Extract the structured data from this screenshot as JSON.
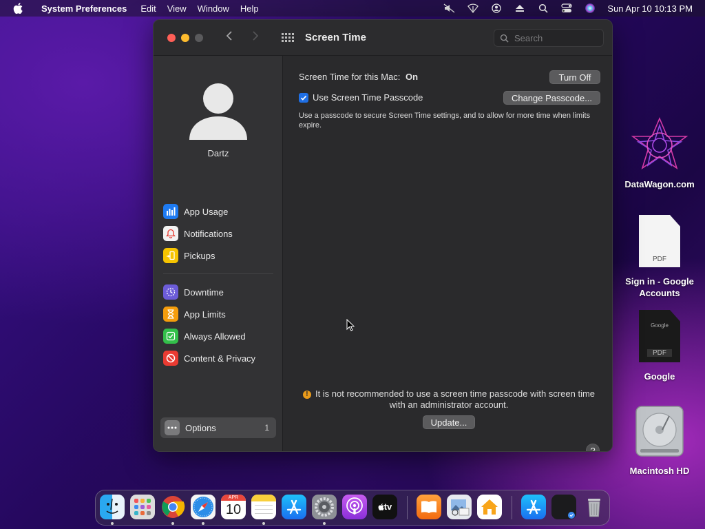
{
  "menubar": {
    "app_name": "System Preferences",
    "items": [
      "Edit",
      "View",
      "Window",
      "Help"
    ],
    "clock": "Sun Apr 10  10:13 PM",
    "tray_icons": [
      "mute-icon",
      "wifi-icon",
      "user-icon",
      "eject-icon",
      "search-icon",
      "control-center-icon",
      "siri-icon"
    ]
  },
  "window": {
    "title": "Screen Time",
    "search_placeholder": "Search"
  },
  "sidebar": {
    "user_name": "Dartz",
    "items": [
      {
        "label": "App Usage",
        "icon": "app-usage-icon",
        "color": "#1e7bf2"
      },
      {
        "label": "Notifications",
        "icon": "notifications-icon",
        "color": "#f2f2f2"
      },
      {
        "label": "Pickups",
        "icon": "pickups-icon",
        "color": "#f6c400"
      },
      {
        "label": "Downtime",
        "icon": "downtime-icon",
        "color": "#6c5cd8"
      },
      {
        "label": "App Limits",
        "icon": "app-limits-icon",
        "color": "#f59d0c"
      },
      {
        "label": "Always Allowed",
        "icon": "always-allowed-icon",
        "color": "#33c04a"
      },
      {
        "label": "Content & Privacy",
        "icon": "content-privacy-icon",
        "color": "#ea3b32"
      }
    ],
    "options": {
      "label": "Options",
      "badge": "1"
    }
  },
  "main": {
    "status_label": "Screen Time for this Mac:",
    "status_value": "On",
    "turn_off_label": "Turn Off",
    "passcode_label": "Use Screen Time Passcode",
    "change_passcode_label": "Change Passcode...",
    "description": "Use a passcode to secure Screen Time settings, and to allow for more time when limits expire.",
    "warning": "It is not recommended to use a screen time passcode with screen time with an administrator account.",
    "update_label": "Update...",
    "help_label": "?"
  },
  "desktop": {
    "icons": [
      {
        "label": "DataWagon.com"
      },
      {
        "label": "Sign in - Google Accounts",
        "file_tag": "PDF"
      },
      {
        "label": "Google",
        "file_tag": "PDF",
        "doc_text": "Google"
      },
      {
        "label": "Macintosh HD"
      }
    ]
  },
  "dock": {
    "calendar_month": "APR",
    "calendar_day": "10",
    "tv_label": "tv",
    "apps": [
      "finder-icon",
      "launchpad-icon",
      "chrome-icon",
      "safari-icon",
      "calendar-icon",
      "notes-icon",
      "app-store-icon",
      "system-preferences-icon",
      "podcasts-icon",
      "apple-tv-icon",
      "books-icon",
      "preview-icon",
      "home-icon",
      "app-store-folder-icon",
      "screen-recording-icon",
      "trash-icon"
    ]
  }
}
